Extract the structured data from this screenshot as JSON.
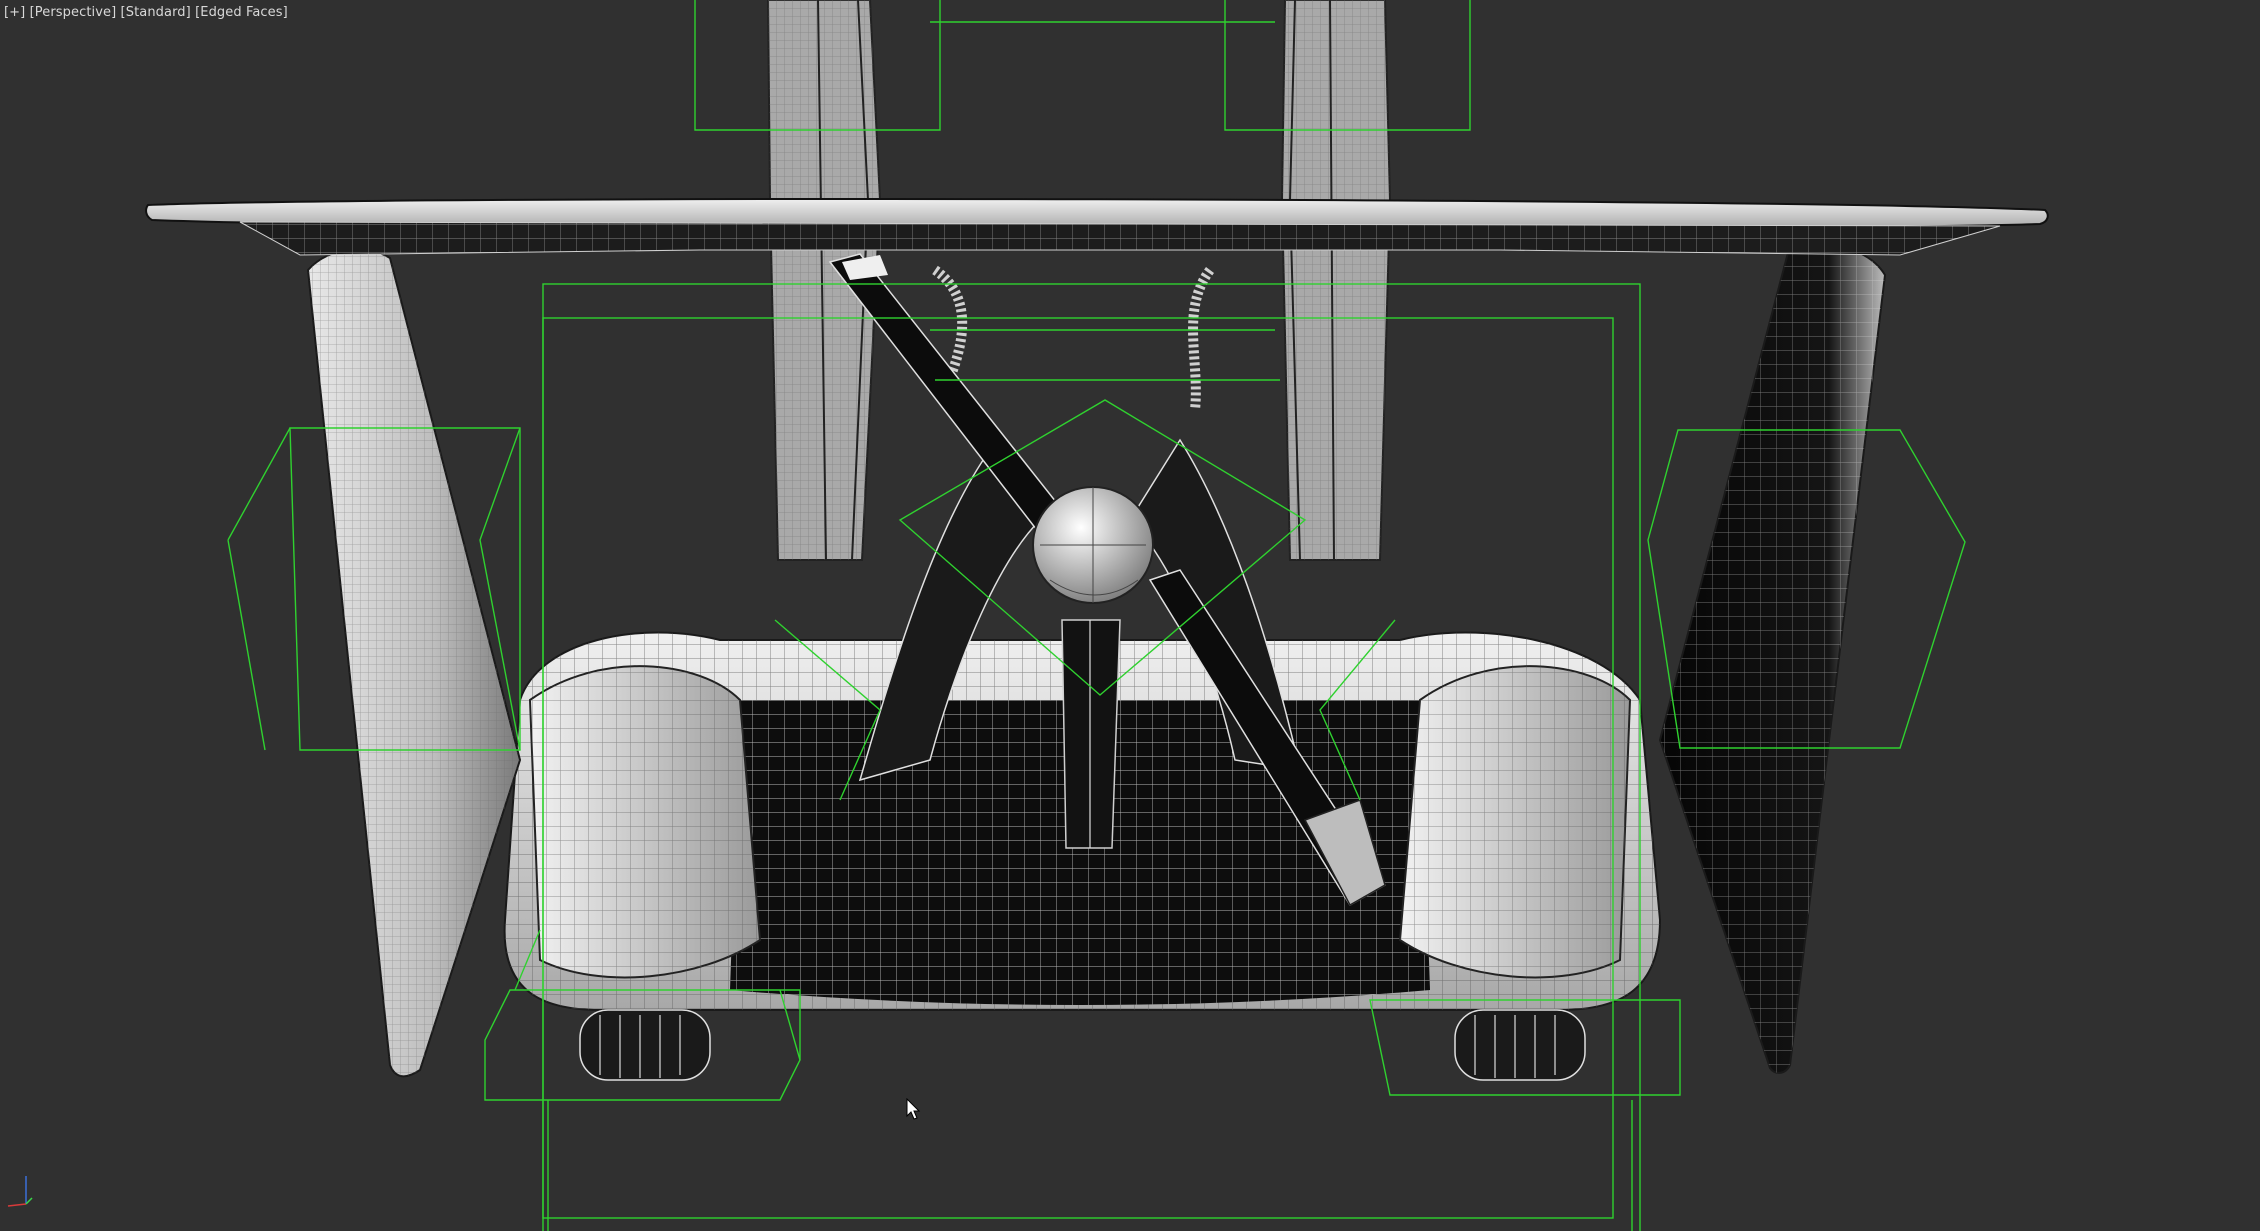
{
  "viewport": {
    "label_plus": "[+]",
    "label_view": "[Perspective]",
    "label_shading": "[Standard]",
    "label_display": "[Edged Faces]"
  },
  "scene": {
    "background_color": "#303030",
    "selection_box_color": "#2fd12f",
    "mesh_light_color": "#d9d9d9",
    "mesh_dark_color": "#0c0c0c",
    "wire_color": "#ffffff",
    "object": "aircraft-front-view-mesh"
  },
  "icons": {
    "cursor": "mouse-pointer-icon",
    "axis": "axis-tripod-icon"
  }
}
